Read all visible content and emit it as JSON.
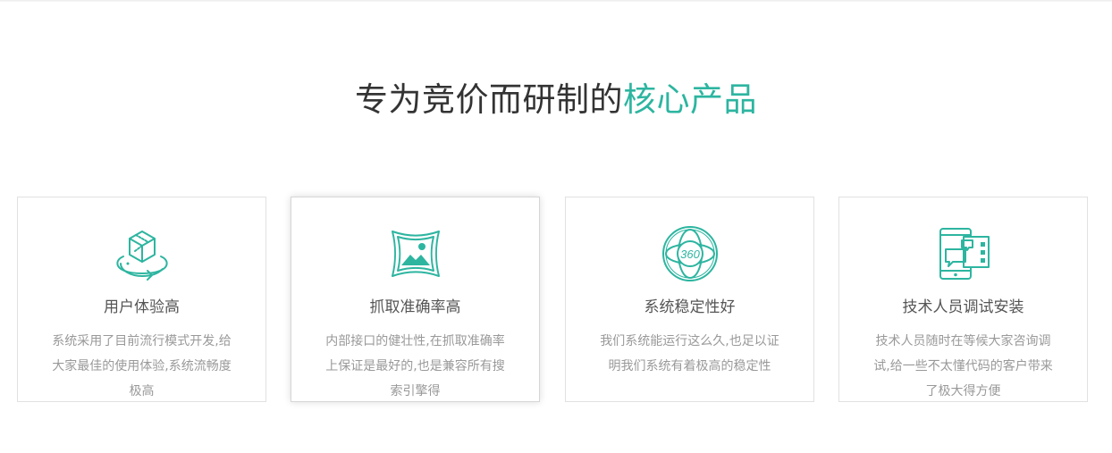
{
  "header": {
    "title_plain": "专为竞价而研制的",
    "title_accent": "核心产品"
  },
  "accent_color": "#2db5a0",
  "cards": [
    {
      "icon": "3d-cube-rotate-icon",
      "title": "用户体验高",
      "desc": "系统采用了目前流行模式开发,给大家最佳的使用体验,系统流畅度极高"
    },
    {
      "icon": "panorama-image-icon",
      "title": "抓取准确率高",
      "desc": "内部接口的健壮性,在抓取准确率上保证是最好的,也是兼容所有搜索引擎得"
    },
    {
      "icon": "360-globe-icon",
      "title": "系统稳定性好",
      "desc": "我们系统能运行这么久,也足以证明我们系统有着极高的稳定性"
    },
    {
      "icon": "mobile-support-icon",
      "title": "技术人员调试安装",
      "desc": "技术人员随时在等候大家咨询调试,给一些不太懂代码的客户带来了极大得方便"
    }
  ]
}
